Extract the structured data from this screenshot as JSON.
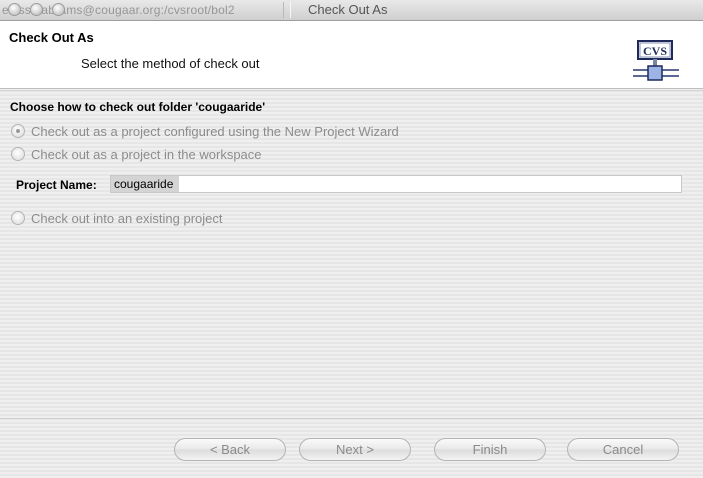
{
  "window": {
    "path_title": "extssh:abrams@cougaar.org:/cvsroot/bol2",
    "title": "Check Out As"
  },
  "header": {
    "title": "Check Out As",
    "description": "Select the method of check out",
    "icon": "cvs-icon",
    "icon_text": "CVS"
  },
  "content": {
    "group_label": "Choose how to check out folder 'cougaaride'",
    "options": [
      {
        "label": "Check out as a project configured using the New Project Wizard",
        "selected": true
      },
      {
        "label": "Check out as a project in the workspace",
        "selected": false
      },
      {
        "label": "Check out into an existing project",
        "selected": false
      }
    ],
    "project_name_label": "Project Name:",
    "project_name_value": "cougaaride"
  },
  "buttons": {
    "back": "< Back",
    "next": "Next >",
    "finish": "Finish",
    "cancel": "Cancel"
  }
}
